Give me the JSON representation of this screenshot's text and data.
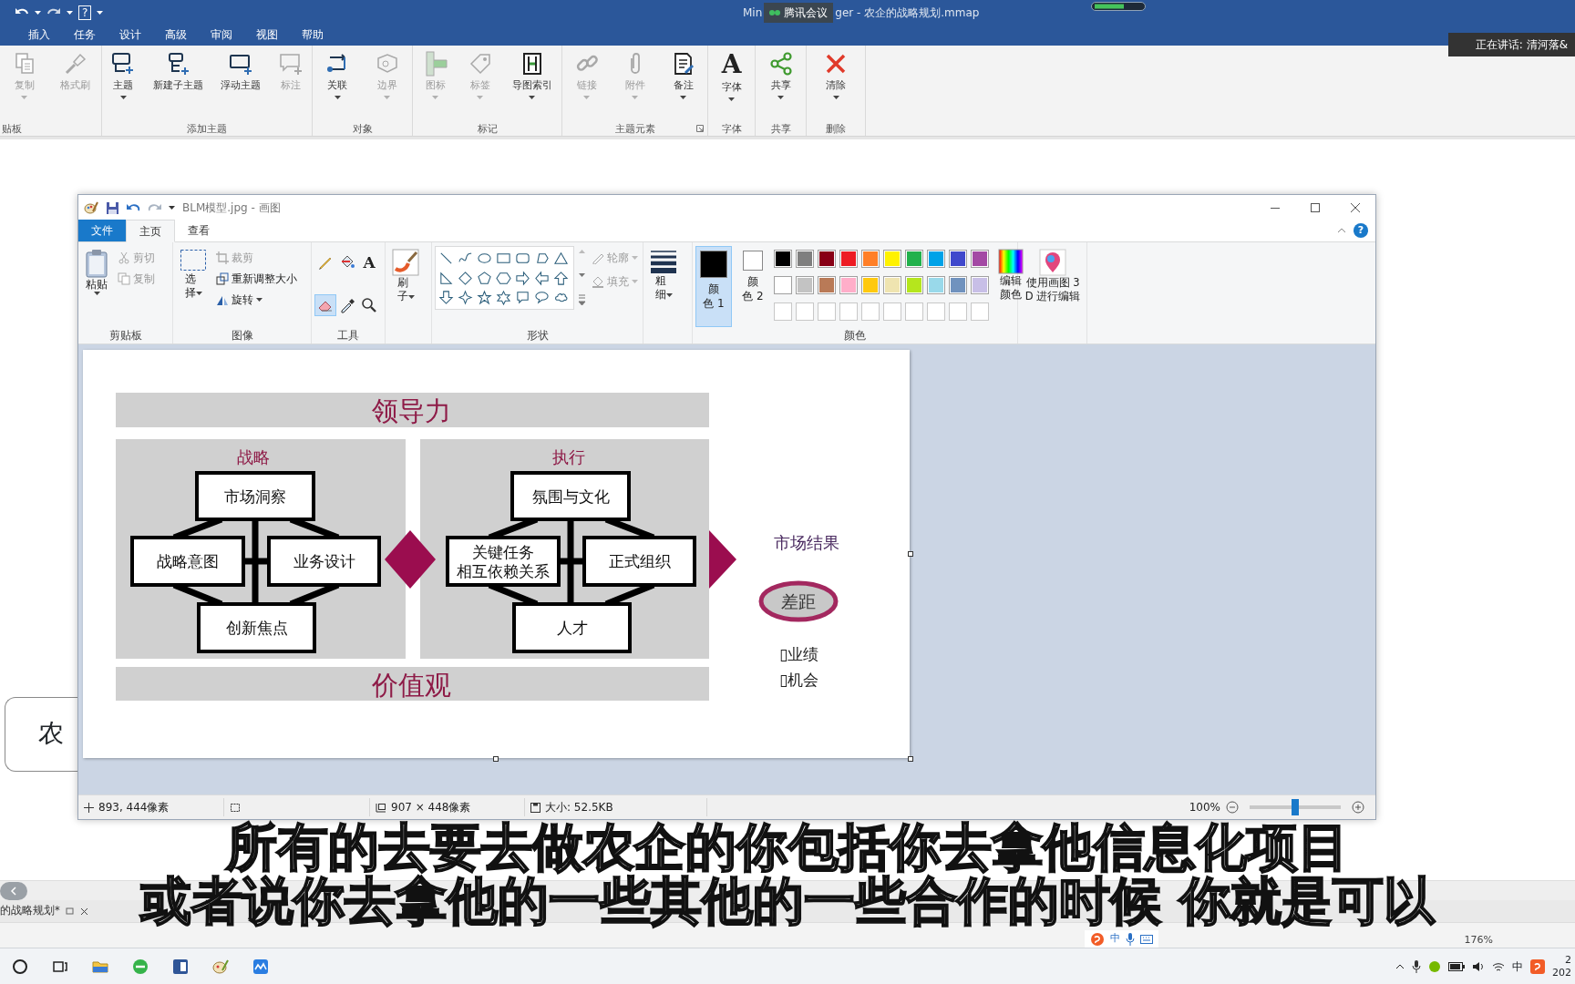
{
  "app": {
    "title_start": "Min",
    "meeting_badge": "腾讯会议",
    "title_end": "ger - 农企的战略规划.mmap",
    "help_glyph": "?",
    "speaker": "正在讲话: 清河落&"
  },
  "ribbon_tabs": [
    {
      "label": "插入"
    },
    {
      "label": "任务"
    },
    {
      "label": "设计"
    },
    {
      "label": "高级"
    },
    {
      "label": "审阅"
    },
    {
      "label": "视图"
    },
    {
      "label": "帮助"
    }
  ],
  "mm_ribbon": {
    "groups": [
      {
        "label": "贴板",
        "launcher": false,
        "buttons": [
          {
            "label": "复制",
            "disabled": true,
            "dropdown": true
          },
          {
            "label": "格式刷",
            "disabled": true,
            "dropdown": false
          }
        ]
      },
      {
        "label": "添加主题",
        "launcher": false,
        "buttons": [
          {
            "label": "主题",
            "disabled": false,
            "dropdown": true
          },
          {
            "label": "新建子主题",
            "disabled": false,
            "dropdown": false
          },
          {
            "label": "浮动主题",
            "disabled": false,
            "dropdown": false
          },
          {
            "label": "标注",
            "disabled": true,
            "dropdown": false
          }
        ]
      },
      {
        "label": "对象",
        "launcher": false,
        "buttons": [
          {
            "label": "关联",
            "disabled": false,
            "dropdown": true
          },
          {
            "label": "边界",
            "disabled": true,
            "dropdown": true
          }
        ]
      },
      {
        "label": "标记",
        "launcher": false,
        "buttons": [
          {
            "label": "图标",
            "disabled": true,
            "dropdown": true
          },
          {
            "label": "标签",
            "disabled": true,
            "dropdown": true
          },
          {
            "label": "导图索引",
            "disabled": false,
            "dropdown": true
          }
        ]
      },
      {
        "label": "主题元素",
        "launcher": true,
        "buttons": [
          {
            "label": "链接",
            "disabled": true,
            "dropdown": true
          },
          {
            "label": "附件",
            "disabled": true,
            "dropdown": true
          },
          {
            "label": "备注",
            "disabled": false,
            "dropdown": true
          }
        ]
      },
      {
        "label": "字体",
        "launcher": false,
        "buttons": [
          {
            "label": "字体",
            "glyph": "A",
            "disabled": false,
            "dropdown": true
          }
        ]
      },
      {
        "label": "共享",
        "launcher": false,
        "buttons": [
          {
            "label": "共享",
            "disabled": false,
            "dropdown": true
          }
        ]
      },
      {
        "label": "删除",
        "launcher": false,
        "buttons": [
          {
            "label": "清除",
            "disabled": false,
            "dropdown": true
          }
        ]
      }
    ]
  },
  "canvas": {
    "node_text": "农"
  },
  "paint": {
    "title": "BLM模型.jpg - 画图",
    "help_glyph": "?",
    "tabs": [
      {
        "label": "文件",
        "kind": "file",
        "selected": false
      },
      {
        "label": "主页",
        "kind": "tab",
        "selected": true
      },
      {
        "label": "查看",
        "kind": "tab",
        "selected": false
      }
    ],
    "clipboard": {
      "label": "剪贴板",
      "paste": "粘贴",
      "cut": {
        "label": "剪切",
        "disabled": true
      },
      "copy": {
        "label": "复制",
        "disabled": true
      }
    },
    "image": {
      "label": "图像",
      "select": "选择",
      "crop": {
        "label": "裁剪",
        "disabled": true
      },
      "resize": {
        "label": "重新调整大小",
        "disabled": false
      },
      "rotate": {
        "label": "旋转",
        "disabled": false
      }
    },
    "tools": {
      "label": "工具",
      "items": [
        {
          "kind": "pencil",
          "selected": false
        },
        {
          "kind": "fill",
          "selected": false
        },
        {
          "kind": "text",
          "glyph": "A",
          "selected": false
        },
        {
          "kind": "eraser",
          "selected": true
        },
        {
          "kind": "picker",
          "selected": false
        },
        {
          "kind": "magnifier",
          "selected": false
        }
      ]
    },
    "brush": "刷子",
    "shapes": {
      "label": "形状",
      "outline": {
        "label": "轮廓",
        "disabled": true
      },
      "fill": {
        "label": "填充",
        "disabled": true
      }
    },
    "size": "粗细",
    "colors": {
      "label": "颜色",
      "color1": {
        "label": "颜色 1",
        "selected": true,
        "color": "#000000"
      },
      "color2": {
        "label": "颜色 2",
        "selected": false,
        "color": "#ffffff"
      },
      "palette": [
        {
          "color": "#000000"
        },
        {
          "color": "#7f7f7f"
        },
        {
          "color": "#880015"
        },
        {
          "color": "#ed1c24"
        },
        {
          "color": "#ff7f27"
        },
        {
          "color": "#fff200"
        },
        {
          "color": "#22b14c"
        },
        {
          "color": "#00a2e8"
        },
        {
          "color": "#3f48cc"
        },
        {
          "color": "#a349a4"
        },
        {
          "color": "#ffffff"
        },
        {
          "color": "#c3c3c3"
        },
        {
          "color": "#b97a57"
        },
        {
          "color": "#ffaec9"
        },
        {
          "color": "#ffc90e"
        },
        {
          "color": "#efe4b0"
        },
        {
          "color": "#b5e61d"
        },
        {
          "color": "#99d9ea"
        },
        {
          "color": "#7092be"
        },
        {
          "color": "#c8bfe7"
        }
      ],
      "edit": "编辑颜色"
    },
    "paint3d": "使用画图 3D 进行编辑",
    "diagram": {
      "top_band": "领导力",
      "bottom_band": "价值观",
      "panels": [
        {
          "title": "战略",
          "boxes": [
            [
              "市场洞察"
            ],
            [
              "战略意图"
            ],
            [
              "业务设计"
            ],
            [
              "创新焦点"
            ]
          ]
        },
        {
          "title": "执行",
          "boxes": [
            [
              "氛围与文化"
            ],
            [
              "关键任务",
              "相互依赖关系"
            ],
            [
              "正式组织"
            ],
            [
              "人才"
            ]
          ]
        }
      ],
      "result_title": "市场结果",
      "gap": "差距",
      "items": [
        "▯业绩",
        "▯机会"
      ]
    },
    "status": {
      "cursor": "893, 444像素",
      "size": "907 × 448像素",
      "file_size": "大小: 52.5KB",
      "zoom": "100%",
      "zoom_slider": {
        "level": 0.5
      }
    }
  },
  "doc_tab": "的战略规划*",
  "mm_status": {
    "ime": "中",
    "zoom": "176%"
  },
  "taskbar": {
    "ime": "中",
    "clock": [
      "2",
      "202"
    ]
  },
  "subtitles": [
    "所有的去要去做农企的你包括你去拿他信息化项目",
    "或者说你去拿他的一些其他的一些合作的时候 你就是可以"
  ]
}
